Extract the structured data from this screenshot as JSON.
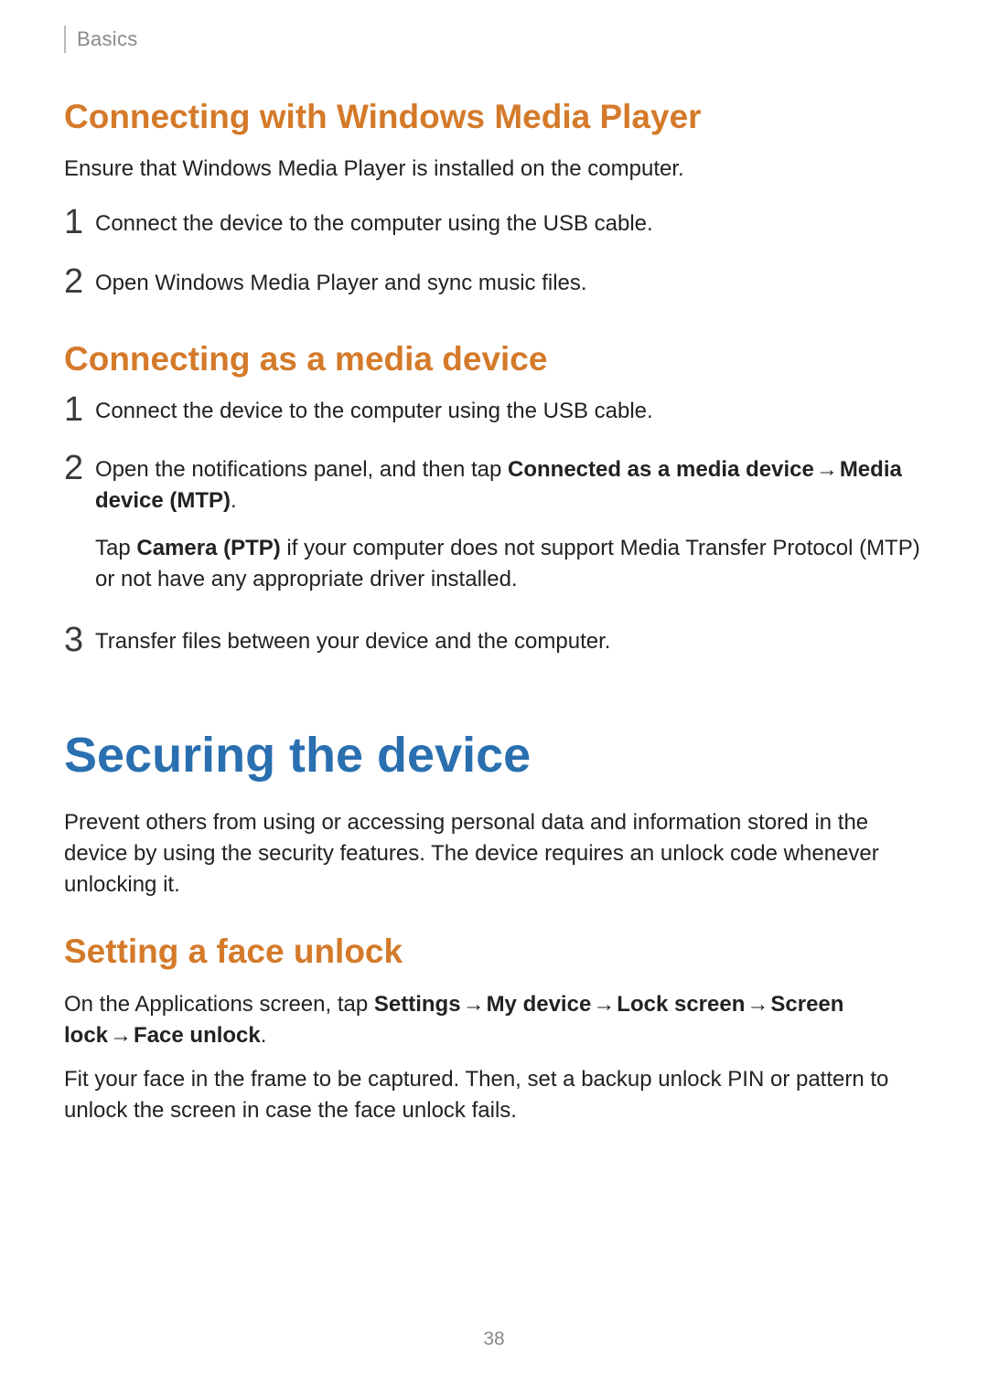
{
  "colors": {
    "accent_orange": "#d47a2a",
    "accent_blue": "#2a6fb0",
    "muted": "#8a8a8a"
  },
  "arrow": "→",
  "header": {
    "section": "Basics"
  },
  "page_number": "38",
  "wmp": {
    "heading": "Connecting with Windows Media Player",
    "intro": "Ensure that Windows Media Player is installed on the computer.",
    "steps": {
      "n1": "1",
      "s1": "Connect the device to the computer using the USB cable.",
      "n2": "2",
      "s2": "Open Windows Media Player and sync music files."
    }
  },
  "media": {
    "heading": "Connecting as a media device",
    "steps": {
      "n1": "1",
      "s1": "Connect the device to the computer using the USB cable.",
      "n2": "2",
      "s2_pre": "Open the notifications panel, and then tap ",
      "s2_b1": "Connected as a media device",
      "s2_b2": "Media device (MTP)",
      "s2_post": ".",
      "s2b_pre": "Tap ",
      "s2b_b1": "Camera (PTP)",
      "s2b_post": " if your computer does not support Media Transfer Protocol (MTP) or not have any appropriate driver installed.",
      "n3": "3",
      "s3": "Transfer files between your device and the computer."
    }
  },
  "securing": {
    "heading": "Securing the device",
    "intro": "Prevent others from using or accessing personal data and information stored in the device by using the security features. The device requires an unlock code whenever unlocking it."
  },
  "face": {
    "heading": "Setting a face unlock",
    "p1_pre": "On the Applications screen, tap ",
    "p1_b1": "Settings",
    "p1_b2": "My device",
    "p1_b3": "Lock screen",
    "p1_b4": "Screen lock",
    "p1_b5": "Face unlock",
    "p1_post": ".",
    "p2": "Fit your face in the frame to be captured. Then, set a backup unlock PIN or pattern to unlock the screen in case the face unlock fails."
  }
}
